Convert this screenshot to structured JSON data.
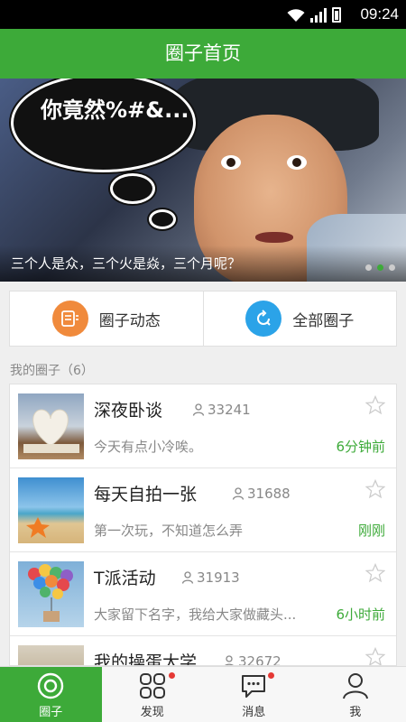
{
  "status_bar": {
    "time": "09:24"
  },
  "header": {
    "title": "圈子首页"
  },
  "banner": {
    "bubble_text": "你竟然%#&...",
    "caption": "三个人是众，三个火是焱，三个月呢？",
    "slide_count": 3,
    "active_slide": 2
  },
  "quick_nav": [
    {
      "label": "圈子动态",
      "icon": "feed-icon",
      "color": "#f08a3c"
    },
    {
      "label": "全部圈子",
      "icon": "refresh-circle-icon",
      "color": "#2ba3e8"
    }
  ],
  "section": {
    "my_circles_label": "我的圈子（6）"
  },
  "circles": [
    {
      "title": "深夜卧谈",
      "members": "33241",
      "desc": "今天有点小冷唉。",
      "time": "6分钟前"
    },
    {
      "title": "每天自拍一张",
      "members": "31688",
      "desc": "第一次玩，不知道怎么弄",
      "time": "刚刚"
    },
    {
      "title": "T派活动",
      "members": "31913",
      "desc": "大家留下名字，我给大家做藏头...",
      "time": "6小时前"
    },
    {
      "title": "我的操蛋大学",
      "members": "32672",
      "desc": "",
      "time": ""
    }
  ],
  "tabs": [
    {
      "label": "圈子",
      "icon": "circle-target-icon",
      "active": true,
      "badge": false
    },
    {
      "label": "发现",
      "icon": "grid-icon",
      "active": false,
      "badge": true
    },
    {
      "label": "消息",
      "icon": "chat-bubble-icon",
      "active": false,
      "badge": true
    },
    {
      "label": "我",
      "icon": "person-icon",
      "active": false,
      "badge": false
    }
  ],
  "colors": {
    "brand_green": "#3daa39",
    "badge_red": "#e53935"
  }
}
